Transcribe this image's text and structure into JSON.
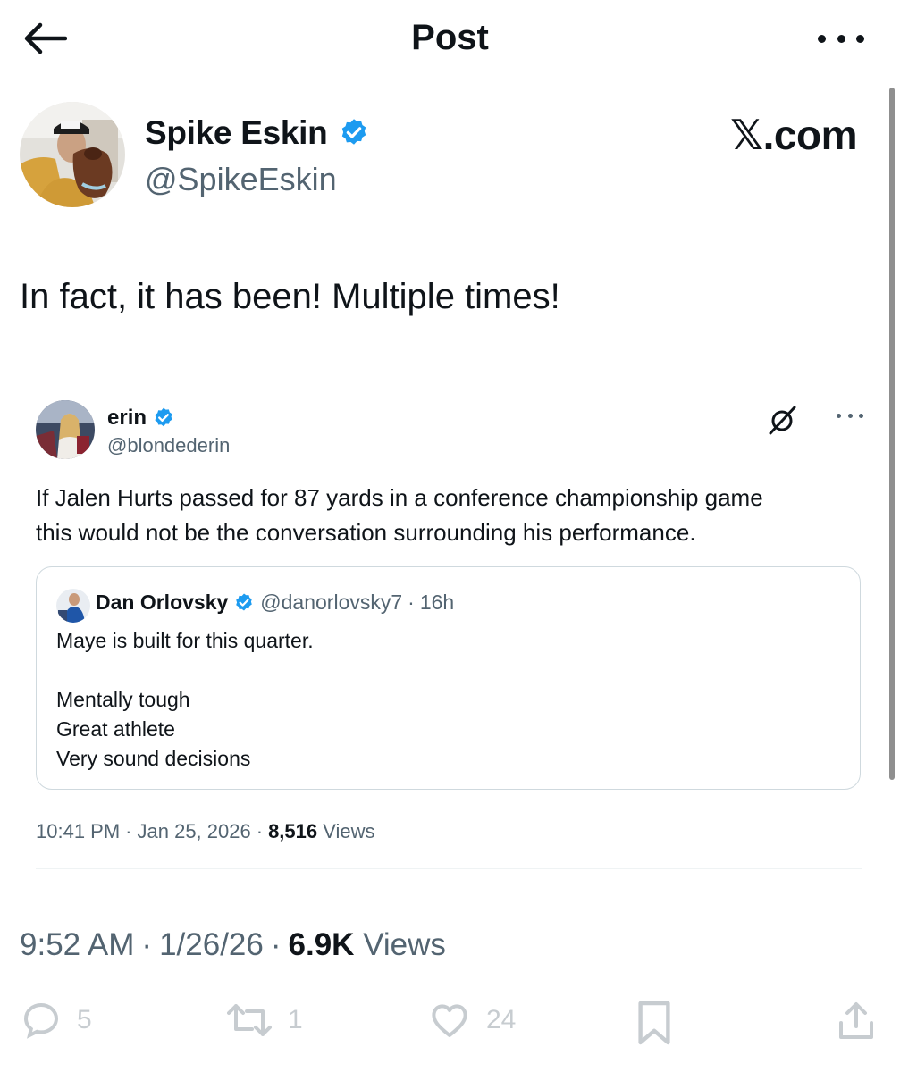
{
  "header": {
    "title": "Post"
  },
  "author": {
    "name": "Spike Eskin",
    "handle": "@SpikeEskin",
    "verified": true
  },
  "watermark": "𝕏.com",
  "post": {
    "text": "In fact, it has been! Multiple times!",
    "time": "9:52 AM",
    "date": "1/26/26",
    "views_count": "6.9K",
    "views_label": "Views"
  },
  "quoted": {
    "name": "erin",
    "handle": "@blondederin",
    "verified": true,
    "text_lines": [
      "If Jalen Hurts passed for 87 yards in a conference championship game",
      "this would not be the conversation surrounding his performance."
    ],
    "time": "10:41 PM",
    "date": "Jan 25, 2026",
    "views_count": "8,516",
    "views_label": "Views",
    "inner": {
      "name": "Dan Orlovsky",
      "handle": "@danorlovsky7",
      "age": "16h",
      "lines": [
        "Maye is built for this quarter.",
        "",
        "Mentally tough",
        "Great athlete",
        "Very sound decisions"
      ]
    }
  },
  "separator": "·",
  "actions": {
    "replies": "5",
    "reposts": "1",
    "likes": "24"
  },
  "icons": {
    "back": "back-arrow-icon",
    "more": "more-icon",
    "verified": "verified-badge-icon",
    "grok": "grok-icon",
    "reply": "reply-icon",
    "repost": "repost-icon",
    "like": "like-icon",
    "bookmark": "bookmark-icon",
    "share": "share-icon"
  },
  "colors": {
    "verified": "#1d9bf0",
    "text": "#0f1419",
    "secondary": "#536471",
    "border": "#cfd9de"
  }
}
